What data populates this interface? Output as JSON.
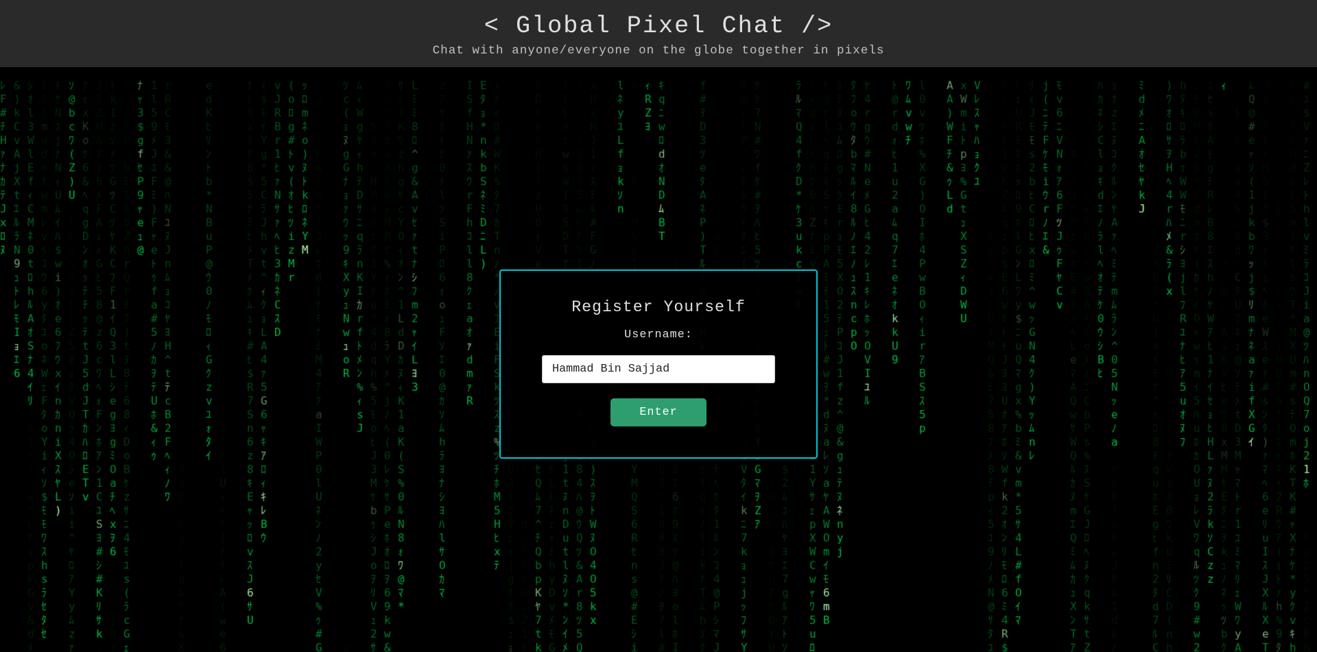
{
  "header": {
    "title": "< Global Pixel Chat />",
    "subtitle": "Chat with anyone/everyone on the globe together in pixels"
  },
  "register": {
    "title": "Register Yourself",
    "username_label": "Username:",
    "username_value": "Hammad Bin Sajjad",
    "enter_button": "Enter"
  },
  "colors": {
    "header_bg": "#2a2a2a",
    "dialog_border": "#00c8d7",
    "enter_button_bg": "#2e9e6e",
    "title_text": "#e0e0e0",
    "subtitle_text": "#c0c0c0"
  }
}
